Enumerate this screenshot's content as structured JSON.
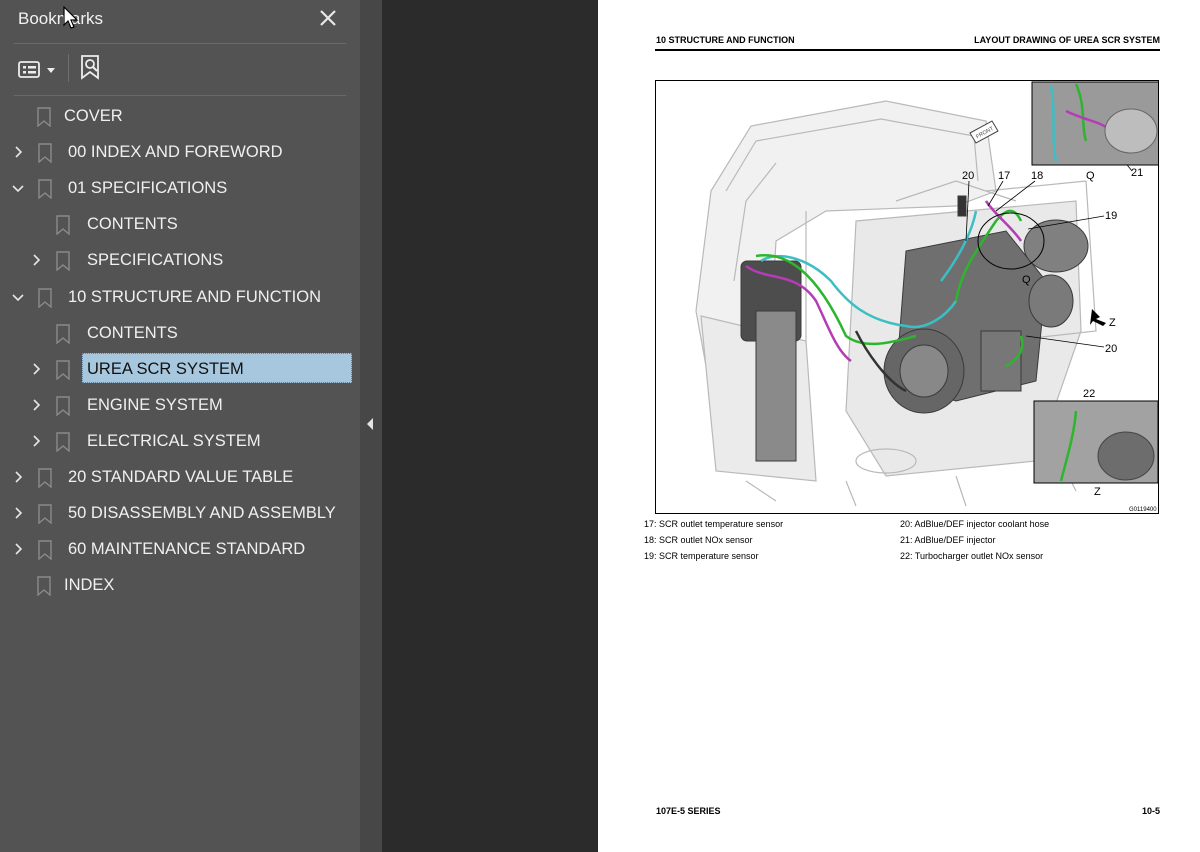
{
  "bookmarks_panel": {
    "title": "Bookmarks",
    "close_icon": "close-icon",
    "items": [
      {
        "label": "COVER",
        "level": 0,
        "expand": "none"
      },
      {
        "label": "00 INDEX AND FOREWORD",
        "level": 0,
        "expand": "collapsed"
      },
      {
        "label": "01 SPECIFICATIONS",
        "level": 0,
        "expand": "expanded"
      },
      {
        "label": "CONTENTS",
        "level": 1,
        "expand": "none"
      },
      {
        "label": "SPECIFICATIONS",
        "level": 1,
        "expand": "collapsed"
      },
      {
        "label": "10 STRUCTURE AND FUNCTION",
        "level": 0,
        "expand": "expanded"
      },
      {
        "label": "CONTENTS",
        "level": 1,
        "expand": "none"
      },
      {
        "label": "UREA SCR SYSTEM",
        "level": 1,
        "expand": "collapsed",
        "selected": true
      },
      {
        "label": "ENGINE SYSTEM",
        "level": 1,
        "expand": "collapsed"
      },
      {
        "label": "ELECTRICAL SYSTEM",
        "level": 1,
        "expand": "collapsed"
      },
      {
        "label": "20 STANDARD VALUE TABLE",
        "level": 0,
        "expand": "collapsed"
      },
      {
        "label": "50 DISASSEMBLY AND ASSEMBLY",
        "level": 0,
        "expand": "collapsed"
      },
      {
        "label": "60 MAINTENANCE STANDARD",
        "level": 0,
        "expand": "collapsed"
      },
      {
        "label": "INDEX",
        "level": 0,
        "expand": "none"
      }
    ]
  },
  "colors": {
    "sidebar_bg": "#535353",
    "selection": "#a7c7df",
    "doc_bg": "#2b2b2b",
    "urea_line_green": "#2db52d",
    "urea_line_cyan": "#3bbfc4",
    "urea_line_magenta": "#b43cb4"
  },
  "page": {
    "header_left": "10 STRUCTURE AND FUNCTION",
    "header_right": "LAYOUT DRAWING OF UREA SCR SYSTEM",
    "figure": {
      "callouts": {
        "c20a": "20",
        "c17": "17",
        "c18": "18",
        "cQ1": "Q",
        "c21": "21",
        "c19": "19",
        "cQ2": "Q",
        "cZ1": "Z",
        "c20b": "20",
        "c22": "22",
        "cZ2": "Z"
      },
      "front_label": "FRONT",
      "figure_id": "G0119400"
    },
    "captions": {
      "c17": "17: SCR outlet temperature sensor",
      "c18": "18: SCR outlet NOx sensor",
      "c19": "19: SCR temperature sensor",
      "c20": "20: AdBlue/DEF injector coolant hose",
      "c21": "21: AdBlue/DEF injector",
      "c22": "22: Turbocharger outlet NOx sensor"
    },
    "footer_left": "107E-5 SERIES",
    "footer_right": "10-5"
  }
}
